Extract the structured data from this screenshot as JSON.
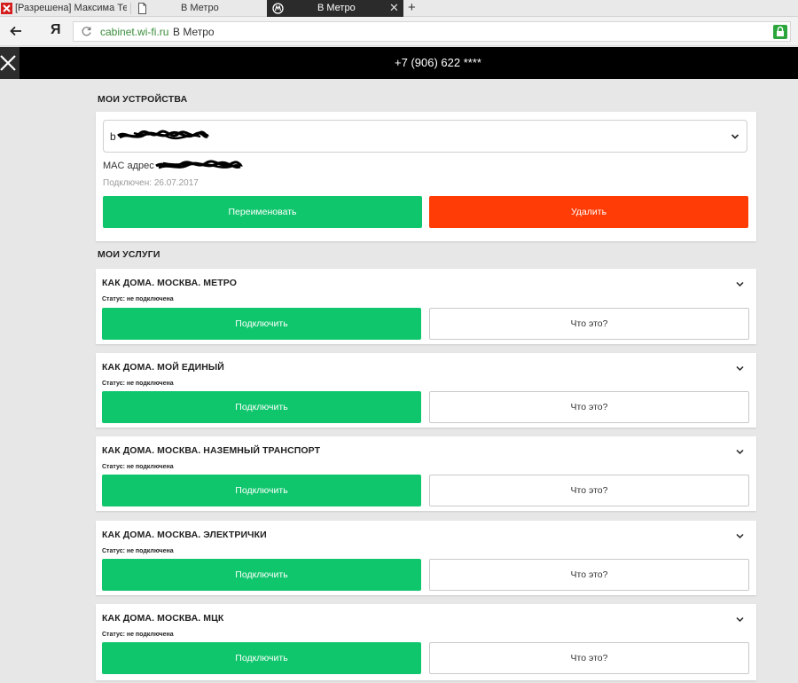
{
  "browser": {
    "tabs": [
      {
        "label": "[Разрешена] Максима Теле",
        "icon": "x-logo-icon",
        "active": false
      },
      {
        "label": "В Метро",
        "icon": "document-icon",
        "active": false
      },
      {
        "label": "В Метро",
        "icon": "metro-logo-icon",
        "active": true
      }
    ],
    "url_domain": "cabinet.wi-fi.ru",
    "page_title": "В Метро",
    "yandex_logo": "Я",
    "accent_secure": "#2aa63c"
  },
  "header": {
    "phone": "+7 (906) 622 ****"
  },
  "devices": {
    "section_title": "МОИ УСТРОЙСТВА",
    "device_name_visible": "b",
    "mac_label": "MAC адрес",
    "connected": "Подключен: 26.07.2017",
    "rename_label": "Переименовать",
    "delete_label": "Удалить"
  },
  "services": {
    "section_title": "МОИ УСЛУГИ",
    "connect_label": "Подключить",
    "info_label": "Что это?",
    "items": [
      {
        "title": "КАК ДОМА. МОСКВА. МЕТРО",
        "status": "Статус: не подключена"
      },
      {
        "title": "КАК ДОМА. МОЙ ЕДИНЫЙ",
        "status": "Статус: не подключена"
      },
      {
        "title": "КАК ДОМА. МОСКВА. НАЗЕМНЫЙ ТРАНСПОРТ",
        "status": "Статус: не подключена"
      },
      {
        "title": "КАК ДОМА. МОСКВА. ЭЛЕКТРИЧКИ",
        "status": "Статус: не подключена"
      },
      {
        "title": "КАК ДОМА. МОСКВА. МЦК",
        "status": "Статус: не подключена"
      }
    ]
  },
  "colors": {
    "green": "#10c66c",
    "red": "#ff3c06",
    "header_bg": "#000000",
    "page_bg": "#e7e7e7"
  }
}
